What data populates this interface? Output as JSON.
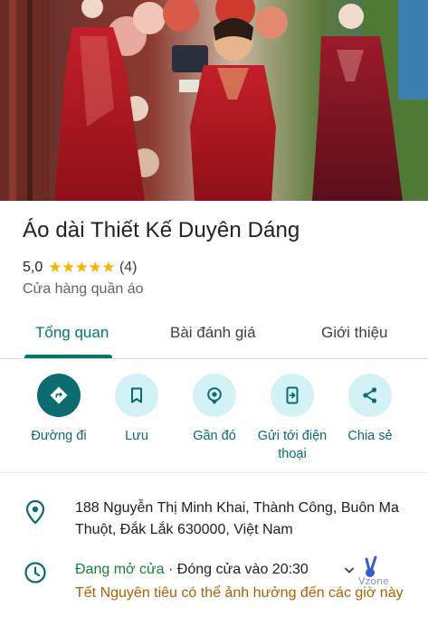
{
  "place": {
    "title": "Áo dài Thiết Kế Duyên Dáng",
    "rating": "5,0",
    "stars": "★★★★★",
    "review_count": "(4)",
    "category": "Cửa hàng quần áo"
  },
  "tabs": [
    {
      "label": "Tổng quan",
      "active": true
    },
    {
      "label": "Bài đánh giá",
      "active": false
    },
    {
      "label": "Giới thiệu",
      "active": false
    }
  ],
  "actions": [
    {
      "label": "Đường đi",
      "icon": "directions-icon"
    },
    {
      "label": "Lưu",
      "icon": "bookmark-icon"
    },
    {
      "label": "Gần đó",
      "icon": "nearby-icon"
    },
    {
      "label": "Gửi tới điện thoại",
      "icon": "send-to-phone-icon"
    },
    {
      "label": "Chia sẻ",
      "icon": "share-icon"
    }
  ],
  "address": {
    "text": "188 Nguyễn Thị Minh Khai, Thành Công, Buôn Ma Thuột, Đắk Lắk 630000, Việt Nam"
  },
  "hours": {
    "status": "Đang mở cửa",
    "separator": " · ",
    "closing": "Đóng cửa vào 20:30",
    "notice": "Tết Nguyên tiêu có thể ảnh hưởng đến các giờ này"
  },
  "watermark": {
    "text": "Vzone"
  },
  "colors": {
    "accent": "#00796b",
    "primary_button": "#0b6b6f",
    "secondary_button": "#d3f2f6",
    "star": "#f5b400",
    "open": "#188038",
    "warning": "#b06000"
  }
}
